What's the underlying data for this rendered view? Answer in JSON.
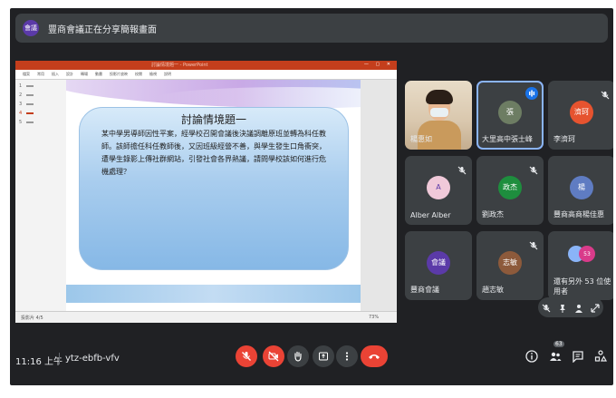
{
  "banner": {
    "avatar_text": "會議",
    "text": "豐商會議正在分享簡報畫面"
  },
  "presentation": {
    "window_title": "討論情境題一 - PowerPoint",
    "ribbon_tabs": [
      "檔案",
      "常用",
      "插入",
      "設計",
      "轉場",
      "動畫",
      "投影片放映",
      "校閱",
      "檢視",
      "說明"
    ],
    "slide_numbers": [
      "1",
      "2",
      "3",
      "4",
      "5"
    ],
    "slide_title": "討論情境題一",
    "slide_body": "某中學男導師因性平案，經學校召開會議後決議調離原班並轉為科任教師。該師擔任科任教師後，又因班級經營不善，與學生發生口角衝突，遭學生錄影上傳社群網站，引發社會各界熱議，請問學校該如何進行危機處理？",
    "status_left": "投影片 4/5",
    "status_zoom": "73%"
  },
  "participants": [
    {
      "name": "楊惠如",
      "type": "video"
    },
    {
      "name": "大里高中張士峰",
      "type": "avatar",
      "avatar_text": "張",
      "avatar_color": "#6d7d63",
      "speaking": true
    },
    {
      "name": "李濟珂",
      "type": "avatar",
      "avatar_text": "濟珂",
      "avatar_color": "#e6532f",
      "muted": true
    },
    {
      "name": "Alber Alber",
      "type": "avatar",
      "avatar_text": "A",
      "avatar_color": "#f0c9d9",
      "muted": true
    },
    {
      "name": "劉政杰",
      "type": "avatar",
      "avatar_text": "政杰",
      "avatar_color": "#1e8e3e",
      "muted": true
    },
    {
      "name": "豐商高商楊佳惠",
      "type": "avatar",
      "avatar_text": "楊",
      "avatar_color": "#5f7cc2",
      "muted": false
    },
    {
      "name": "豐商會議",
      "type": "avatar",
      "avatar_text": "會議",
      "avatar_color": "#5b3aa8",
      "muted": false
    },
    {
      "name": "趙志敏",
      "type": "avatar",
      "avatar_text": "志敏",
      "avatar_color": "#8d5a3b",
      "muted": true
    },
    {
      "name": "還有另外 53 位使用者",
      "type": "others",
      "count_badge": "53"
    }
  ],
  "controls": {
    "time": "11:16 上午",
    "meeting_code": "ytz-ebfb-vfv",
    "participant_badge": "63"
  },
  "colors": {
    "bg": "#202124",
    "tile": "#3c4043",
    "danger": "#ea4335",
    "active": "#8ab4f8"
  },
  "icons": [
    "mic-off-icon",
    "camera-off-icon",
    "raise-hand-icon",
    "present-icon",
    "more-options-icon",
    "end-call-icon",
    "info-icon",
    "people-icon",
    "chat-icon",
    "activities-icon"
  ]
}
